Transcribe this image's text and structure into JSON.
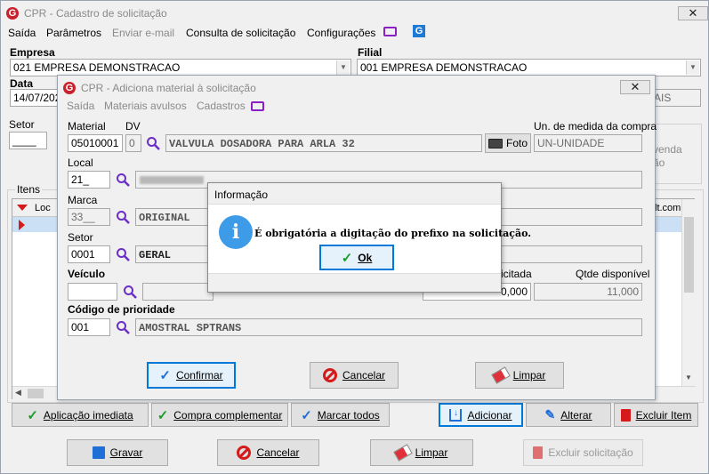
{
  "main": {
    "title": "CPR - Cadastro de solicitação",
    "close": "✕",
    "menu": [
      "Saída",
      "Parâmetros",
      "Enviar e-mail",
      "Consulta de solicitação",
      "Configurações"
    ],
    "empresa_label": "Empresa",
    "empresa_value": "021 EMPRESA DEMONSTRACAO",
    "filial_label": "Filial",
    "filial_value": "001 EMPRESA DEMONSTRACAO",
    "data_label": "Data",
    "data_value": "14/07/202",
    "filial_extra": "AIS",
    "setor_label": "Setor",
    "setor_value": "____",
    "venda_text": "venda",
    "ao_text": "ão",
    "itens_label": "Itens",
    "grid_col_loc": "Loc",
    "grid_col_right": "lt.com",
    "bottom_row1": [
      "Aplicação imediata",
      "Compra complementar",
      "Marcar todos",
      "Adicionar",
      "Alterar",
      "Excluir Item"
    ],
    "bottom_row2": [
      "Gravar",
      "Cancelar",
      "Limpar",
      "Excluir solicitação"
    ]
  },
  "dialog": {
    "title": "CPR - Adiciona material à solicitação",
    "close": "✕",
    "menu": [
      "Saída",
      "Materiais avulsos",
      "Cadastros"
    ],
    "material_label": "Material",
    "material_value": "05010001",
    "dv_label": "DV",
    "dv_value": "0",
    "material_desc": "VALVULA DOSADORA PARA ARLA 32",
    "foto_label": "Foto",
    "un_label": "Un. de medida da compra",
    "un_value": "UN-UNIDADE",
    "local_label": "Local",
    "local_value": "21_",
    "local_desc": "",
    "marca_label": "Marca",
    "marca_value": "33__",
    "marca_desc": "ORIGINAL",
    "setor_label": "Setor",
    "setor_value": "0001",
    "setor_desc": "GERAL",
    "veiculo_label": "Veículo",
    "veiculo_value": "",
    "solicitada_label": "icitada",
    "solicitada_value": "0,000",
    "qtde_label": "Qtde disponível",
    "qtde_value": "11,000",
    "prioridade_label": "Código de prioridade",
    "prioridade_value": "001",
    "prioridade_desc": "AMOSTRAL SPTRANS",
    "confirmar": "Confirmar",
    "cancelar": "Cancelar",
    "limpar": "Limpar"
  },
  "info": {
    "title": "Informação",
    "message": "É obrigatória a digitação do prefixo na solicitação.",
    "ok": "Ok"
  },
  "colors": {
    "logo": "#c8202c",
    "focus": "#0078d7",
    "info_icon": "#3d9be8",
    "grid_sel": "#cce0f5"
  }
}
